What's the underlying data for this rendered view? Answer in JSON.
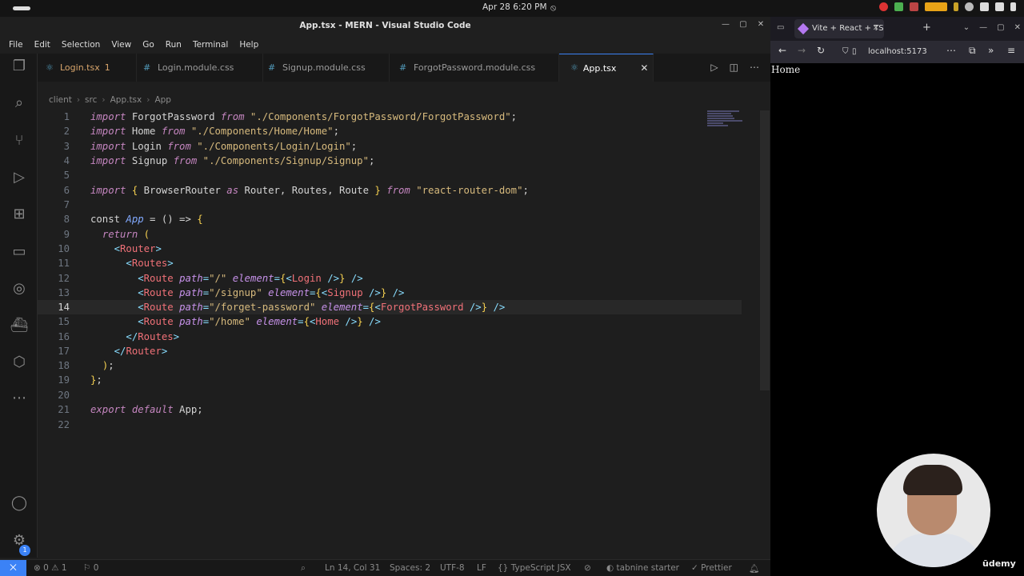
{
  "system": {
    "date_time": "Apr 28  6:20 PM"
  },
  "window": {
    "title": "App.tsx - MERN - Visual Studio Code"
  },
  "menu": [
    "File",
    "Edit",
    "Selection",
    "View",
    "Go",
    "Run",
    "Terminal",
    "Help"
  ],
  "tabs": [
    {
      "label": "Login.tsx",
      "badge": "1",
      "icon": "react-icon"
    },
    {
      "label": "Login.module.css",
      "icon": "css-icon"
    },
    {
      "label": "Signup.module.css",
      "icon": "css-icon"
    },
    {
      "label": "ForgotPassword.module.css",
      "icon": "css-icon"
    },
    {
      "label": "App.tsx",
      "icon": "react-icon",
      "close": "✕"
    }
  ],
  "breadcrumb": [
    "client",
    "src",
    "App.tsx",
    "App"
  ],
  "editor": {
    "current_line": 14,
    "lines": [
      {
        "n": "1",
        "tokens": [
          [
            "kw",
            "import"
          ],
          [
            "plain",
            " ForgotPassword "
          ],
          [
            "kw",
            "from"
          ],
          [
            "str",
            " \"./Components/ForgotPassword/ForgotPassword\""
          ],
          [
            "plain",
            ";"
          ]
        ]
      },
      {
        "n": "2",
        "tokens": [
          [
            "kw",
            "import"
          ],
          [
            "plain",
            " Home "
          ],
          [
            "kw",
            "from"
          ],
          [
            "str",
            " \"./Components/Home/Home\""
          ],
          [
            "plain",
            ";"
          ]
        ]
      },
      {
        "n": "3",
        "tokens": [
          [
            "kw",
            "import"
          ],
          [
            "plain",
            " Login "
          ],
          [
            "kw",
            "from"
          ],
          [
            "str",
            " \"./Components/Login/Login\""
          ],
          [
            "plain",
            ";"
          ]
        ]
      },
      {
        "n": "4",
        "tokens": [
          [
            "kw",
            "import"
          ],
          [
            "plain",
            " Signup "
          ],
          [
            "kw",
            "from"
          ],
          [
            "str",
            " \"./Components/Signup/Signup\""
          ],
          [
            "plain",
            ";"
          ]
        ]
      },
      {
        "n": "5",
        "tokens": []
      },
      {
        "n": "6",
        "tokens": [
          [
            "kw",
            "import"
          ],
          [
            "plain",
            " "
          ],
          [
            "brace",
            "{"
          ],
          [
            "plain",
            " BrowserRouter "
          ],
          [
            "kw",
            "as"
          ],
          [
            "plain",
            " Router, Routes, Route "
          ],
          [
            "brace",
            "}"
          ],
          [
            "plain",
            " "
          ],
          [
            "kw",
            "from"
          ],
          [
            "str",
            " \"react-router-dom\""
          ],
          [
            "plain",
            ";"
          ]
        ]
      },
      {
        "n": "7",
        "tokens": []
      },
      {
        "n": "8",
        "tokens": [
          [
            "plain",
            "const "
          ],
          [
            "fn",
            "App"
          ],
          [
            "plain",
            " = () => "
          ],
          [
            "brace",
            "{"
          ]
        ]
      },
      {
        "n": "9",
        "tokens": [
          [
            "plain",
            "  "
          ],
          [
            "kw",
            "return"
          ],
          [
            "plain",
            " "
          ],
          [
            "brace",
            "("
          ]
        ]
      },
      {
        "n": "10",
        "tokens": [
          [
            "plain",
            "    "
          ],
          [
            "punc",
            "<"
          ],
          [
            "tag",
            "Router"
          ],
          [
            "punc",
            ">"
          ]
        ]
      },
      {
        "n": "11",
        "tokens": [
          [
            "plain",
            "      "
          ],
          [
            "punc",
            "<"
          ],
          [
            "tag",
            "Routes"
          ],
          [
            "punc",
            ">"
          ]
        ]
      },
      {
        "n": "12",
        "tokens": [
          [
            "plain",
            "        "
          ],
          [
            "punc",
            "<"
          ],
          [
            "tag",
            "Route"
          ],
          [
            "plain",
            " "
          ],
          [
            "attr",
            "path"
          ],
          [
            "punc",
            "="
          ],
          [
            "str",
            "\"/\""
          ],
          [
            "plain",
            " "
          ],
          [
            "attr",
            "element"
          ],
          [
            "punc",
            "="
          ],
          [
            "brace",
            "{"
          ],
          [
            "punc",
            "<"
          ],
          [
            "tag",
            "Login"
          ],
          [
            "plain",
            " "
          ],
          [
            "punc",
            "/>"
          ],
          [
            "brace",
            "}"
          ],
          [
            "plain",
            " "
          ],
          [
            "punc",
            "/>"
          ]
        ]
      },
      {
        "n": "13",
        "tokens": [
          [
            "plain",
            "        "
          ],
          [
            "punc",
            "<"
          ],
          [
            "tag",
            "Route"
          ],
          [
            "plain",
            " "
          ],
          [
            "attr",
            "path"
          ],
          [
            "punc",
            "="
          ],
          [
            "str",
            "\"/signup\""
          ],
          [
            "plain",
            " "
          ],
          [
            "attr",
            "element"
          ],
          [
            "punc",
            "="
          ],
          [
            "brace",
            "{"
          ],
          [
            "punc",
            "<"
          ],
          [
            "tag",
            "Signup"
          ],
          [
            "plain",
            " "
          ],
          [
            "punc",
            "/>"
          ],
          [
            "brace",
            "}"
          ],
          [
            "plain",
            " "
          ],
          [
            "punc",
            "/>"
          ]
        ]
      },
      {
        "n": "14",
        "tokens": [
          [
            "plain",
            "        "
          ],
          [
            "punc",
            "<"
          ],
          [
            "tag",
            "Route"
          ],
          [
            "plain",
            " "
          ],
          [
            "attr",
            "path"
          ],
          [
            "punc",
            "="
          ],
          [
            "str",
            "\"/forget-password\""
          ],
          [
            "plain",
            " "
          ],
          [
            "attr",
            "element"
          ],
          [
            "punc",
            "="
          ],
          [
            "brace",
            "{"
          ],
          [
            "punc",
            "<"
          ],
          [
            "tag",
            "ForgotPassword"
          ],
          [
            "plain",
            " "
          ],
          [
            "punc",
            "/>"
          ],
          [
            "brace",
            "}"
          ],
          [
            "plain",
            " "
          ],
          [
            "punc",
            "/>"
          ]
        ]
      },
      {
        "n": "15",
        "tokens": [
          [
            "plain",
            "        "
          ],
          [
            "punc",
            "<"
          ],
          [
            "tag",
            "Route"
          ],
          [
            "plain",
            " "
          ],
          [
            "attr",
            "path"
          ],
          [
            "punc",
            "="
          ],
          [
            "str",
            "\"/home\""
          ],
          [
            "plain",
            " "
          ],
          [
            "attr",
            "element"
          ],
          [
            "punc",
            "="
          ],
          [
            "brace",
            "{"
          ],
          [
            "punc",
            "<"
          ],
          [
            "tag",
            "Home"
          ],
          [
            "plain",
            " "
          ],
          [
            "punc",
            "/>"
          ],
          [
            "brace",
            "}"
          ],
          [
            "plain",
            " "
          ],
          [
            "punc",
            "/>"
          ]
        ]
      },
      {
        "n": "16",
        "tokens": [
          [
            "plain",
            "      "
          ],
          [
            "punc",
            "</"
          ],
          [
            "tag",
            "Routes"
          ],
          [
            "punc",
            ">"
          ]
        ]
      },
      {
        "n": "17",
        "tokens": [
          [
            "plain",
            "    "
          ],
          [
            "punc",
            "</"
          ],
          [
            "tag",
            "Router"
          ],
          [
            "punc",
            ">"
          ]
        ]
      },
      {
        "n": "18",
        "tokens": [
          [
            "plain",
            "  "
          ],
          [
            "brace",
            ")"
          ],
          [
            "plain",
            ";"
          ]
        ]
      },
      {
        "n": "19",
        "tokens": [
          [
            "brace",
            "}"
          ],
          [
            "plain",
            ";"
          ]
        ]
      },
      {
        "n": "20",
        "tokens": []
      },
      {
        "n": "21",
        "tokens": [
          [
            "kw",
            "export"
          ],
          [
            "plain",
            " "
          ],
          [
            "kw",
            "default"
          ],
          [
            "plain",
            " App;"
          ]
        ]
      },
      {
        "n": "22",
        "tokens": []
      }
    ]
  },
  "status": {
    "errors": "0",
    "warnings": "1",
    "ports": "0",
    "position": "Ln 14, Col 31",
    "spaces": "Spaces: 2",
    "encoding": "UTF-8",
    "eol": "LF",
    "language": "TypeScript JSX",
    "tabnine": "tabnine starter",
    "prettier": "Prettier"
  },
  "browser": {
    "tab_title": "Vite + React + TS",
    "url": "localhost:5173",
    "page_text": "Home"
  },
  "watermark": "ūdemy"
}
